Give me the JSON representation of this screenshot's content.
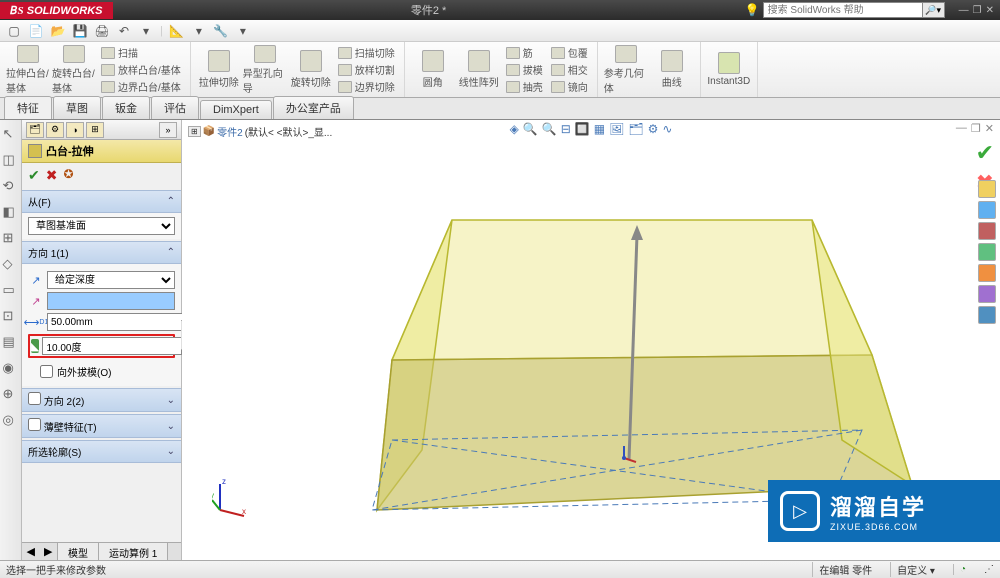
{
  "app": {
    "name": "SOLIDWORKS",
    "doc": "零件2 *"
  },
  "search": {
    "placeholder": "搜索 SolidWorks 帮助",
    "icon": "🔍"
  },
  "quickbar": [
    "▢",
    "📄",
    "📂",
    "💾",
    "🖨",
    "↶",
    "▾",
    "📐",
    "▾",
    "🔧",
    "▾"
  ],
  "ribbon": {
    "big": [
      {
        "label": "拉伸凸台/基体"
      },
      {
        "label": "旋转凸台/基体"
      }
    ],
    "g1": [
      "扫描",
      "放样凸台/基体",
      "边界凸台/基体"
    ],
    "big2": [
      {
        "label": "拉伸切除"
      },
      {
        "label": "异型孔向导"
      },
      {
        "label": "旋转切除"
      }
    ],
    "g2": [
      "扫描切除",
      "放样切割",
      "边界切除"
    ],
    "big3": [
      {
        "label": "圆角"
      },
      {
        "label": "线性阵列"
      }
    ],
    "g3": [
      "筋",
      "拔模",
      "抽壳"
    ],
    "g4": [
      "包覆",
      "相交",
      "镜向"
    ],
    "big4": [
      {
        "label": "参考几何体"
      },
      {
        "label": "曲线"
      },
      {
        "label": "Instant3D"
      }
    ]
  },
  "cmdtabs": [
    "特征",
    "草图",
    "钣金",
    "评估",
    "DimXpert",
    "办公室产品"
  ],
  "feature": {
    "title": "凸台-拉伸",
    "sections": {
      "from": {
        "label": "从(F)",
        "combo": "草图基准面"
      },
      "dir1": {
        "label": "方向 1(1)",
        "endcond": "给定深度",
        "depth": "50.00mm",
        "draft": "10.00度",
        "draft_out": "向外拔模(O)"
      },
      "dir2": {
        "label": "方向 2(2)"
      },
      "thin": {
        "label": "薄壁特征(T)"
      },
      "contours": {
        "label": "所选轮廓(S)"
      }
    }
  },
  "bottom_tabs": [
    "模型",
    "运动算例 1"
  ],
  "breadcrumb": {
    "part": "零件2",
    "config": "(默认< <默认>_显..."
  },
  "viewbar": [
    "◈",
    "🔍",
    "🔍",
    "⊟",
    "🔲",
    "▦",
    "🖼",
    "🗂",
    "⚙",
    "∿"
  ],
  "triad": {
    "x": "x",
    "y": "y",
    "z": "z"
  },
  "watermark": {
    "title": "溜溜自学",
    "url": "ZIXUE.3D66.COM"
  },
  "status": {
    "left": "选择一把手来修改参数",
    "mode": "在编辑 零件",
    "custom": "自定义"
  },
  "right_tool_colors": [
    "#f0d060",
    "#60b0f0",
    "#c06060",
    "#60c080",
    "#f09040",
    "#a070d0",
    "#5090c0"
  ]
}
